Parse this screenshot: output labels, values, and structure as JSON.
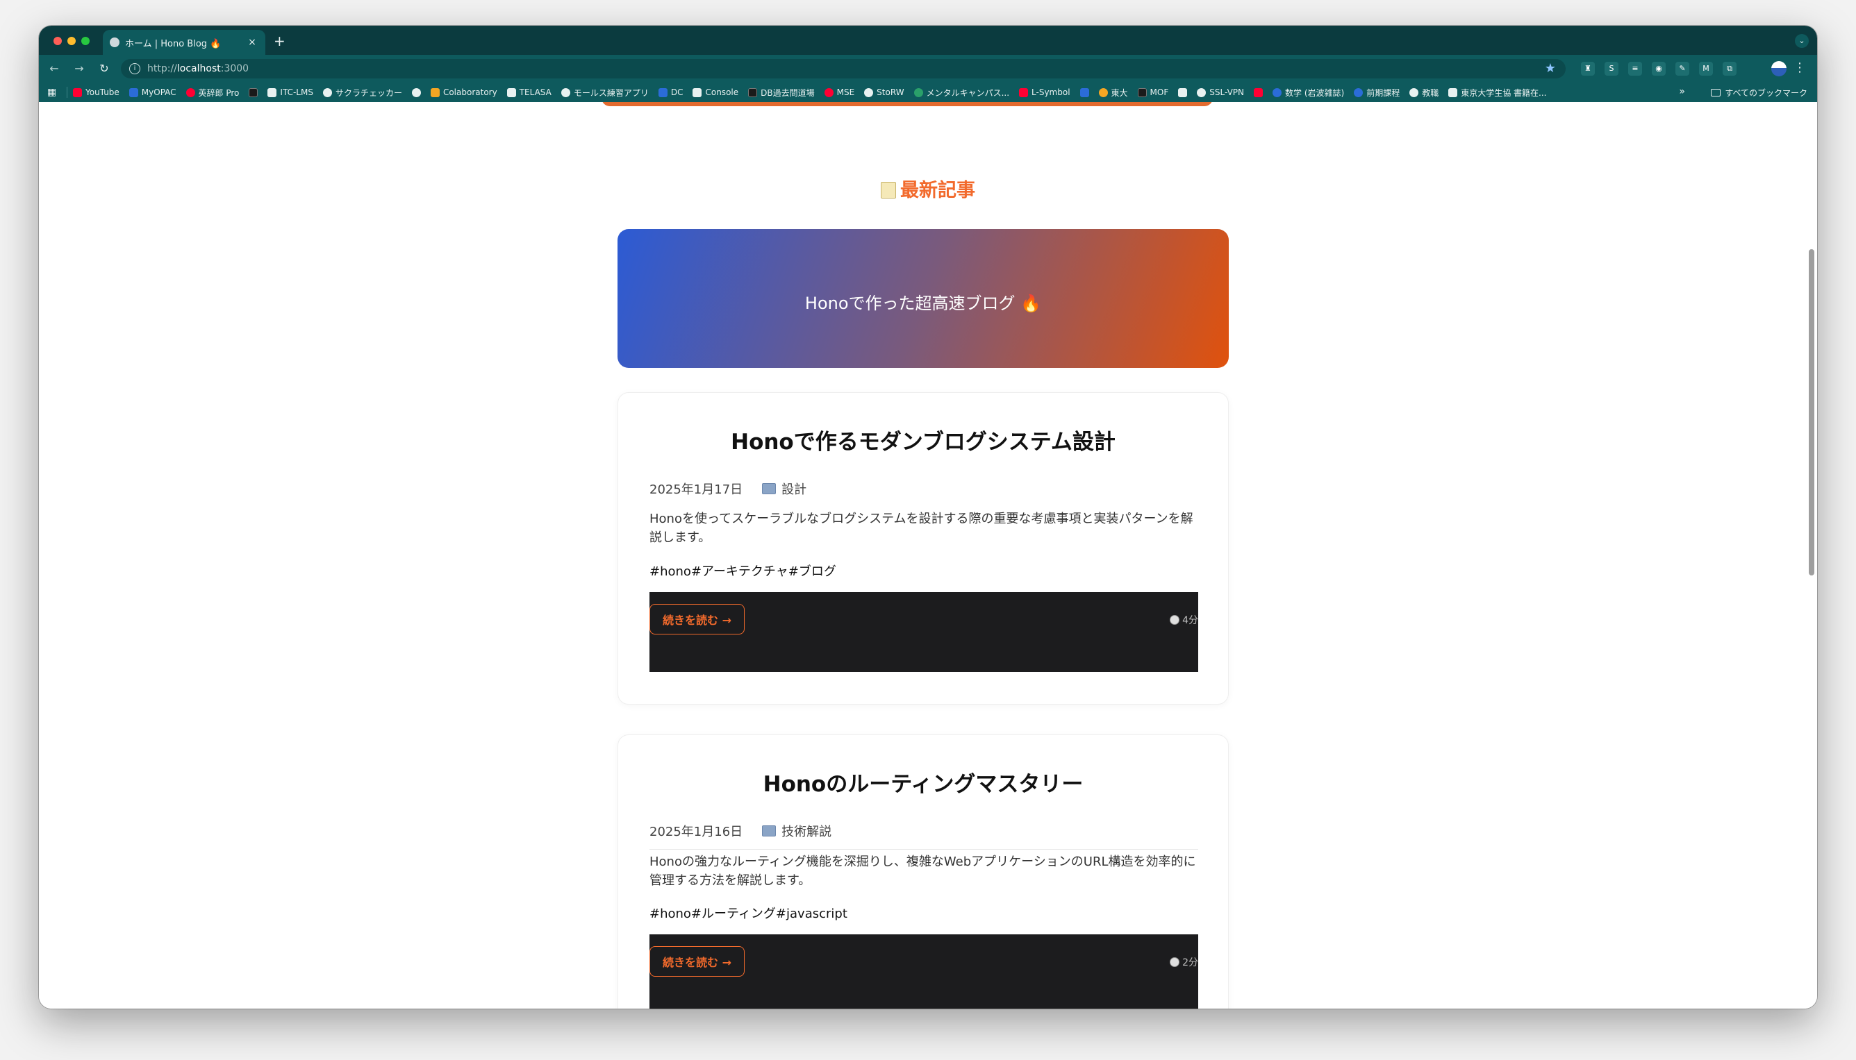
{
  "tab": {
    "title": "ホーム | Hono Blog 🔥",
    "close": "×",
    "new_tab": "+",
    "menu": "⌄"
  },
  "toolbar": {
    "back": "←",
    "forward": "→",
    "reload": "↻",
    "url_prefix": "http://",
    "url_host": "localhost",
    "url_port": ":3000",
    "info_icon": "i",
    "star": "★",
    "menu": "⋮"
  },
  "extensions": [
    "♜",
    "S",
    "≡",
    "◉",
    "✎",
    "M",
    "⧉"
  ],
  "bookmarks": {
    "items": [
      {
        "label": "YouTube",
        "icon": "red"
      },
      {
        "label": "MyOPAC",
        "icon": "blue"
      },
      {
        "label": "英辞郎 Pro",
        "icon": "red round"
      },
      {
        "label": "",
        "icon": "dark"
      },
      {
        "label": "ITC-LMS",
        "icon": ""
      },
      {
        "label": "サクラチェッカー",
        "icon": "round"
      },
      {
        "label": "",
        "icon": "round"
      },
      {
        "label": "Colaboratory",
        "icon": "org"
      },
      {
        "label": "TELASA",
        "icon": ""
      },
      {
        "label": "モールス練習アプリ",
        "icon": "round"
      },
      {
        "label": "DC",
        "icon": "blue"
      },
      {
        "label": "Console",
        "icon": ""
      },
      {
        "label": "DB過去問道場",
        "icon": "dark"
      },
      {
        "label": "MSE",
        "icon": "red round"
      },
      {
        "label": "StoRW",
        "icon": "round"
      },
      {
        "label": "メンタルキャンパス...",
        "icon": "green round"
      },
      {
        "label": "L-Symbol",
        "icon": "red"
      },
      {
        "label": "",
        "icon": "blue"
      },
      {
        "label": "東大",
        "icon": "org round"
      },
      {
        "label": "MOF",
        "icon": "dark"
      },
      {
        "label": "",
        "icon": ""
      },
      {
        "label": "SSL-VPN",
        "icon": "round"
      },
      {
        "label": "",
        "icon": "red"
      },
      {
        "label": "数学 (岩波雑誌)",
        "icon": "blue round"
      },
      {
        "label": "前期課程",
        "icon": "blue round"
      },
      {
        "label": "教職",
        "icon": "round"
      },
      {
        "label": "東京大学生協 書籍在...",
        "icon": ""
      }
    ],
    "more": "»",
    "all_bookmarks": "すべてのブックマーク"
  },
  "page": {
    "section_title": "最新記事",
    "hero_text": "Honoで作った超高速ブログ 🔥",
    "posts": [
      {
        "title": "Honoで作るモダンブログシステム設計",
        "date": "2025年1月17日",
        "category": "設計",
        "description": "Honoを使ってスケーラブルなブログシステムを設計する際の重要な考慮事項と実装パターンを解説します。",
        "tags": "#hono#アーキテクチャ#ブログ",
        "read_more": "続きを読む →",
        "read_time": "4分"
      },
      {
        "title": "Honoのルーティングマスタリー",
        "date": "2025年1月16日",
        "category": "技術解説",
        "description": "Honoの強力なルーティング機能を深掘りし、複雑なWebアプリケーションのURL構造を効率的に管理する方法を解説します。",
        "tags": "#hono#ルーティング#javascript",
        "read_more": "続きを読む →",
        "read_time": "2分"
      }
    ]
  },
  "colors": {
    "accent": "#f26a2c",
    "chrome_dark": "#0b3b3f",
    "chrome": "#0e5a5d",
    "hero_start": "#2c5bd4",
    "hero_end": "#e0520d",
    "footer_bg": "#1c1c1e"
  }
}
